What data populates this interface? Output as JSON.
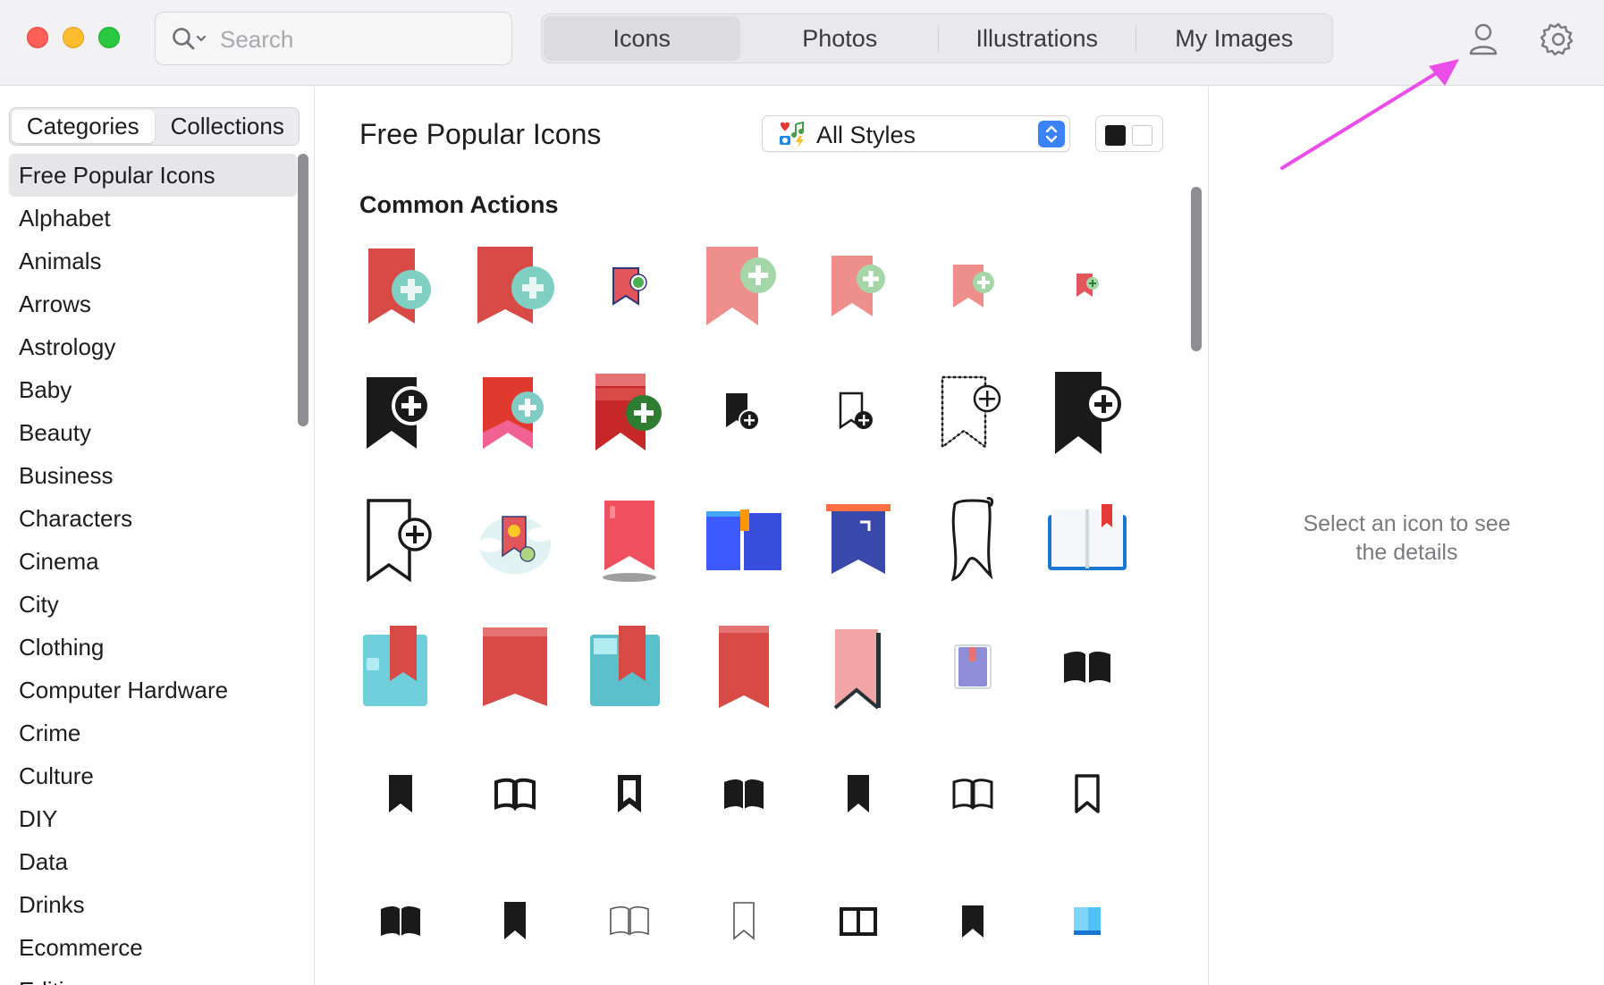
{
  "toolbar": {
    "search_placeholder": "Search",
    "tabs": [
      "Icons",
      "Photos",
      "Illustrations",
      "My Images"
    ],
    "active_tab": "Icons"
  },
  "sidebar": {
    "segments": [
      "Categories",
      "Collections"
    ],
    "active_segment": "Categories",
    "categories": [
      "Free Popular Icons",
      "Alphabet",
      "Animals",
      "Arrows",
      "Astrology",
      "Baby",
      "Beauty",
      "Business",
      "Characters",
      "Cinema",
      "City",
      "Clothing",
      "Computer Hardware",
      "Crime",
      "Culture",
      "DIY",
      "Data",
      "Drinks",
      "Ecommerce",
      "Editing"
    ],
    "selected": "Free Popular Icons"
  },
  "main": {
    "title": "Free Popular Icons",
    "style_select": "All Styles",
    "section_title": "Common Actions",
    "icon_rows": [
      [
        "bookmark-add-3d-clay",
        "bookmark-add-3d-clay-large",
        "bookmark-add-small-outline",
        "bookmark-add-flat-pink",
        "bookmark-add-flat-pink-medium",
        "bookmark-add-flat-pink-small",
        "bookmark-add-flat-pink-tiny"
      ],
      [
        "bookmark-add-black-filled",
        "bookmark-add-red-flat",
        "bookmark-add-red-stacked",
        "bookmark-add-black-small",
        "bookmark-add-outline-small",
        "bookmark-add-dotted-outline",
        "bookmark-add-black-large"
      ],
      [
        "bookmark-add-outline-large",
        "bookmark-cloud-illustration",
        "bookmark-red-shadow",
        "book-blue-bookmark",
        "bookmark-blue-banner",
        "bookmark-hand-drawn",
        "book-open-blue"
      ],
      [
        "book-3d-cyan",
        "bookmark-3d-red",
        "book-3d-cyan-red",
        "bookmark-3d-red-tall",
        "bookmark-pink-folded",
        "book-purple-small",
        "book-open-black"
      ],
      [
        "bookmark-solid",
        "book-open-outline-bold",
        "bookmark-outline-bold",
        "book-open-solid",
        "bookmark-solid-2",
        "book-open-outline",
        "bookmark-outline"
      ],
      [
        "book-open-solid-2",
        "bookmark-solid-3",
        "book-open-thin",
        "bookmark-thin",
        "book-open-square",
        "bookmark-solid-4",
        "book-blue-small"
      ]
    ]
  },
  "details": {
    "placeholder_line1": "Select an icon to see",
    "placeholder_line2": "the details"
  },
  "colors": {
    "accent_blue": "#3b82f6",
    "annotation_arrow": "#e94fe8",
    "clay_red": "#d9534f",
    "pink": "#ee8f8b"
  }
}
